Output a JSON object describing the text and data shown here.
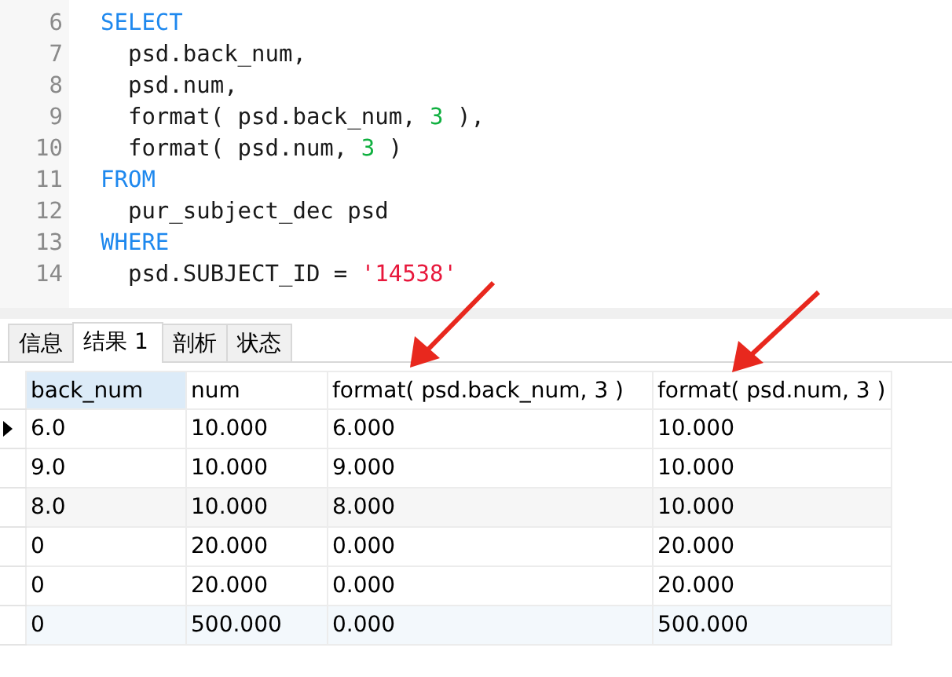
{
  "editor": {
    "lines": [
      {
        "number": "6",
        "tokens": [
          {
            "kind": "keyword",
            "text": "SELECT"
          }
        ]
      },
      {
        "number": "7",
        "tokens": [
          {
            "kind": "plain",
            "text": "  psd.back_num,"
          }
        ]
      },
      {
        "number": "8",
        "tokens": [
          {
            "kind": "plain",
            "text": "  psd.num,"
          }
        ]
      },
      {
        "number": "9",
        "tokens": [
          {
            "kind": "plain",
            "text": "  format( psd.back_num, "
          },
          {
            "kind": "number",
            "text": "3"
          },
          {
            "kind": "plain",
            "text": " ),"
          }
        ]
      },
      {
        "number": "10",
        "tokens": [
          {
            "kind": "plain",
            "text": "  format( psd.num, "
          },
          {
            "kind": "number",
            "text": "3"
          },
          {
            "kind": "plain",
            "text": " )"
          }
        ]
      },
      {
        "number": "11",
        "tokens": [
          {
            "kind": "keyword",
            "text": "FROM"
          }
        ]
      },
      {
        "number": "12",
        "tokens": [
          {
            "kind": "plain",
            "text": "  pur_subject_dec psd"
          }
        ]
      },
      {
        "number": "13",
        "tokens": [
          {
            "kind": "keyword",
            "text": "WHERE"
          }
        ]
      },
      {
        "number": "14",
        "tokens": [
          {
            "kind": "plain",
            "text": "  psd.SUBJECT_ID = "
          },
          {
            "kind": "string",
            "text": "'14538'"
          }
        ]
      }
    ]
  },
  "tabs": [
    {
      "label": "信息",
      "selected": false
    },
    {
      "label": "结果 1",
      "selected": true
    },
    {
      "label": "剖析",
      "selected": false
    },
    {
      "label": "状态",
      "selected": false
    }
  ],
  "table": {
    "columns": [
      {
        "label": "back_num",
        "selected": true
      },
      {
        "label": "num",
        "selected": false
      },
      {
        "label": "format( psd.back_num, 3 )",
        "selected": false
      },
      {
        "label": "format( psd.num, 3 )",
        "selected": false
      }
    ],
    "rows": [
      {
        "selected": true,
        "kind": "plain",
        "cells": [
          "6.0",
          "10.000",
          "6.000",
          "10.000"
        ]
      },
      {
        "selected": false,
        "kind": "plain",
        "cells": [
          "9.0",
          "10.000",
          "9.000",
          "10.000"
        ]
      },
      {
        "selected": false,
        "kind": "striped",
        "cells": [
          "8.0",
          "10.000",
          "8.000",
          "10.000"
        ]
      },
      {
        "selected": false,
        "kind": "plain",
        "cells": [
          "0",
          "20.000",
          "0.000",
          "20.000"
        ]
      },
      {
        "selected": false,
        "kind": "plain",
        "cells": [
          "0",
          "20.000",
          "0.000",
          "20.000"
        ]
      },
      {
        "selected": false,
        "kind": "hovered",
        "cells": [
          "0",
          "500.000",
          "0.000",
          "500.000"
        ]
      }
    ]
  }
}
